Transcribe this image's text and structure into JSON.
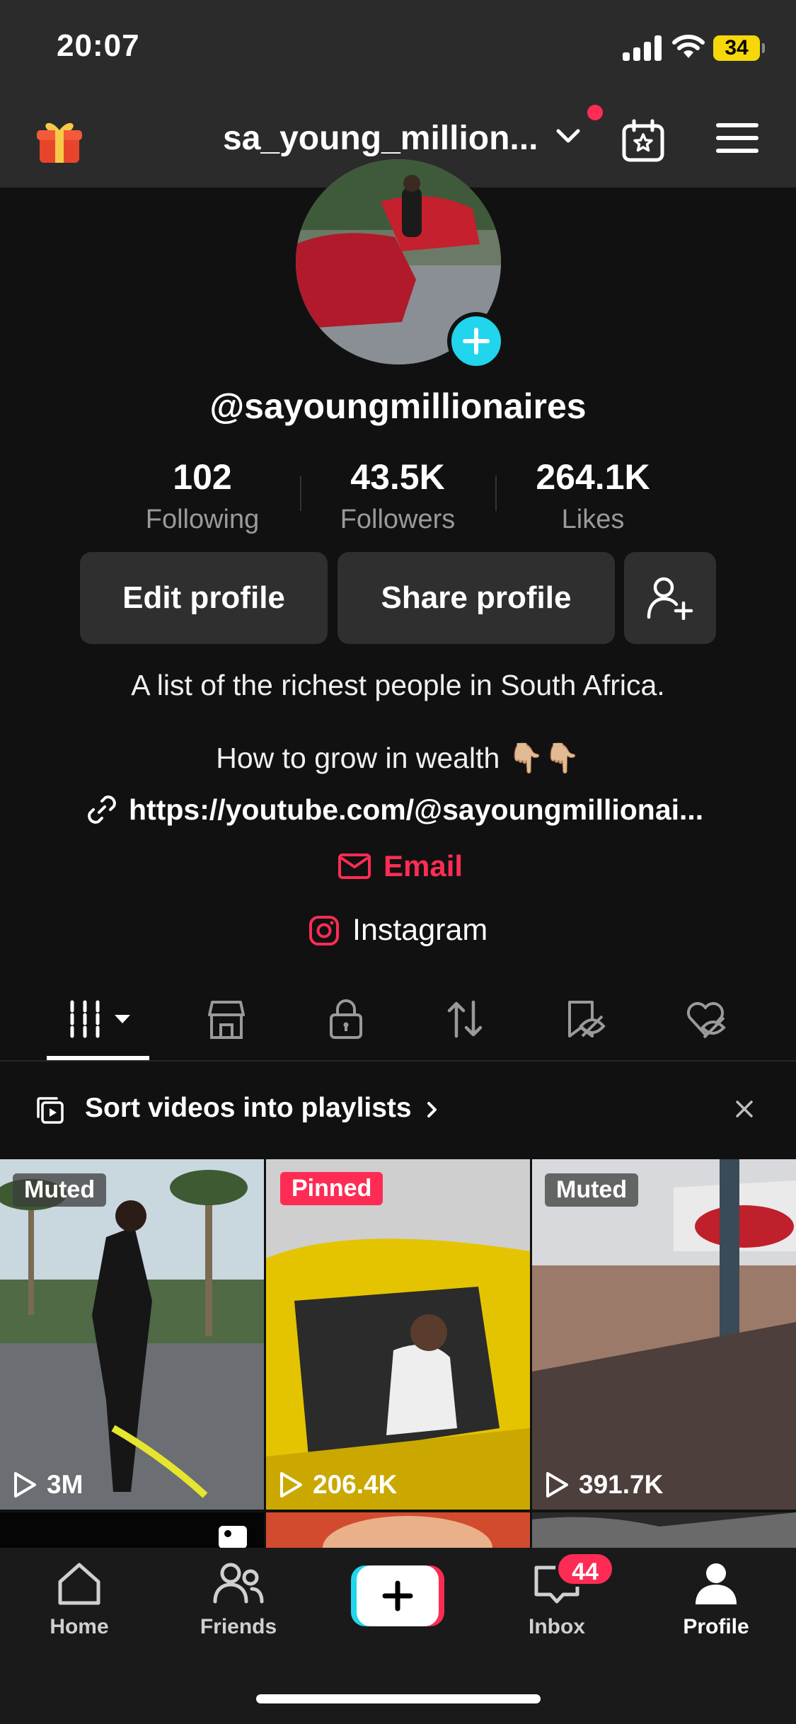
{
  "status_bar": {
    "time": "20:07",
    "battery": "34"
  },
  "header": {
    "username": "sa_young_million..."
  },
  "profile": {
    "handle": "@sayoungmillionaires",
    "stats": [
      {
        "value": "102",
        "label": "Following"
      },
      {
        "value": "43.5K",
        "label": "Followers"
      },
      {
        "value": "264.1K",
        "label": "Likes"
      }
    ],
    "buttons": {
      "edit": "Edit profile",
      "share": "Share profile"
    },
    "bio_line1": "A list of the richest people in South Africa.",
    "bio_line2": "How to grow in wealth 👇🏼👇🏼",
    "link": "https://youtube.com/@sayoungmillionai...",
    "email": "Email",
    "instagram": "Instagram"
  },
  "tabs": [
    "videos-icon",
    "shop-icon",
    "lock-icon",
    "repost-icon",
    "favorites-icon",
    "liked-icon"
  ],
  "playlist_prompt": "Sort videos into playlists",
  "videos": [
    {
      "badge": "Muted",
      "views": "3M"
    },
    {
      "badge": "Pinned",
      "views": "206.4K"
    },
    {
      "badge": "Muted",
      "views": "391.7K"
    }
  ],
  "nav": {
    "home": "Home",
    "friends": "Friends",
    "inbox": "Inbox",
    "inbox_badge": "44",
    "profile": "Profile"
  },
  "colors": {
    "accent": "#fe2c55",
    "cyan": "#20d5ec",
    "background": "#111111",
    "header": "#2b2b2b"
  }
}
